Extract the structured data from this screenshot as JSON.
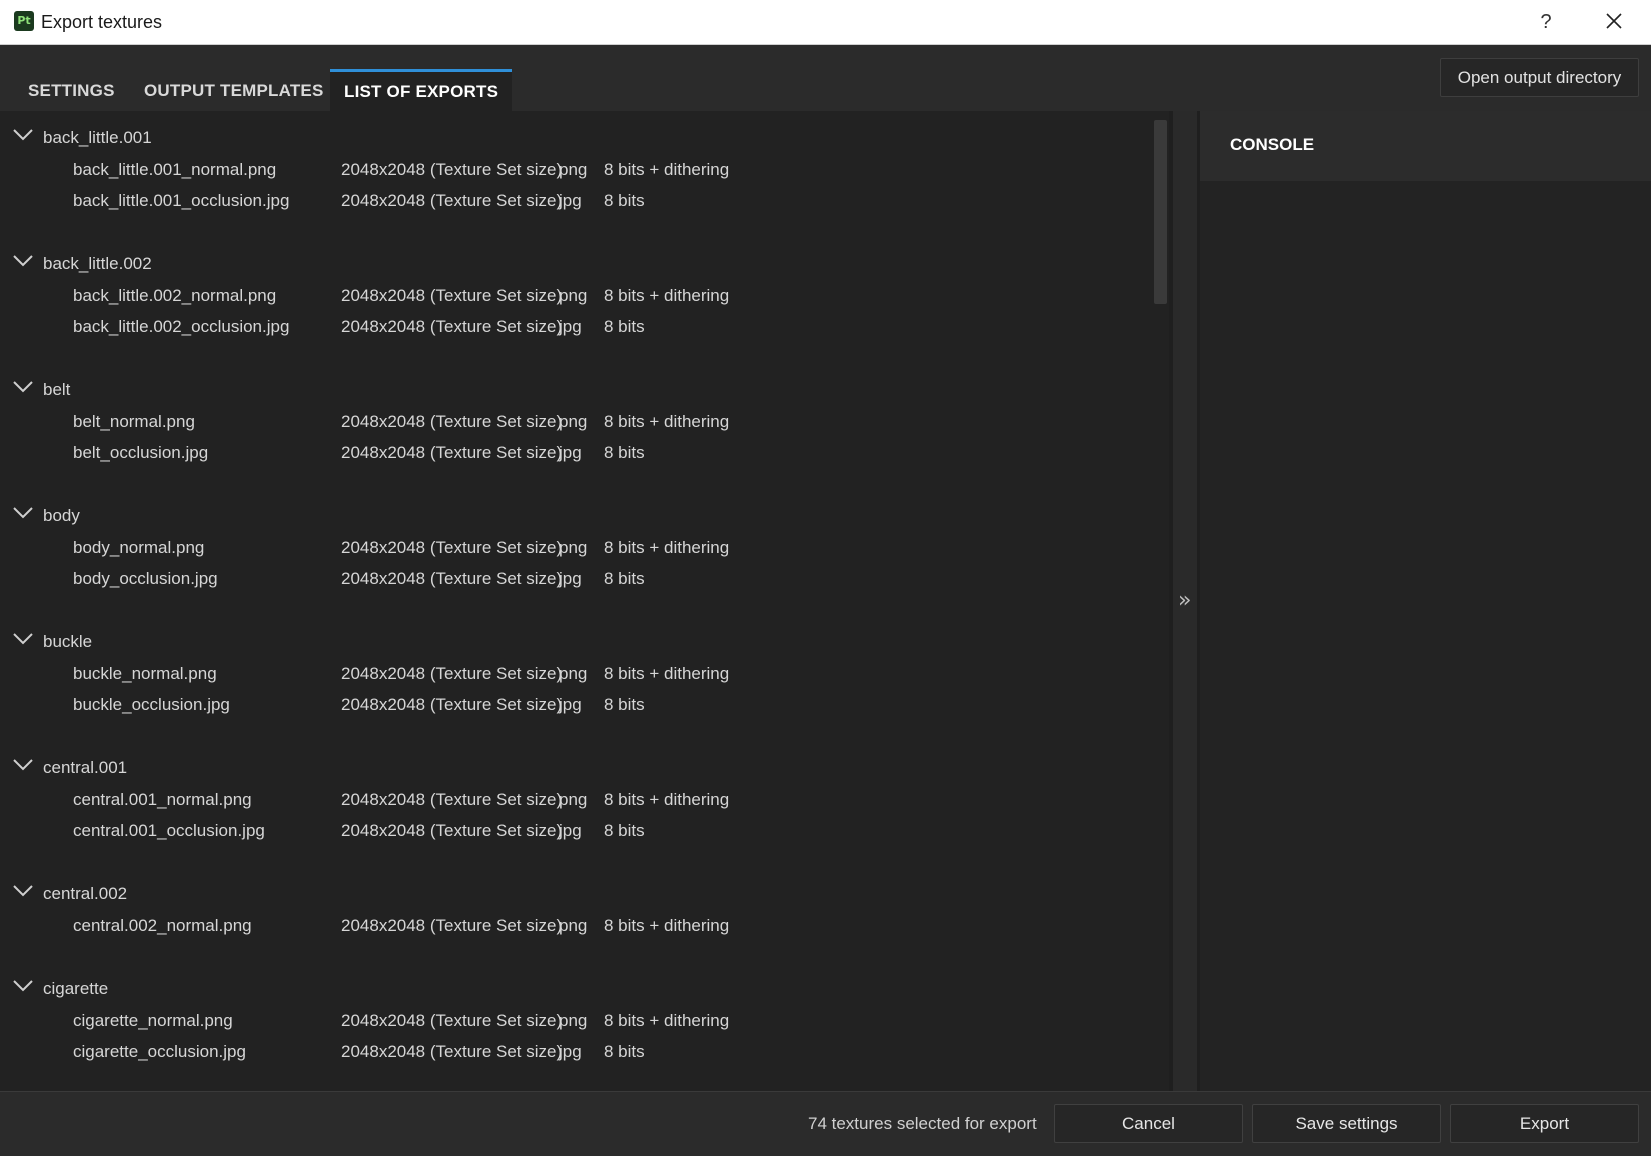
{
  "window": {
    "app_icon_text": "Pt",
    "title": "Export textures",
    "help_label": "?",
    "close_icon": "close-icon"
  },
  "tabs": [
    {
      "label": "SETTINGS",
      "active": false
    },
    {
      "label": "OUTPUT TEMPLATES",
      "active": false
    },
    {
      "label": "LIST OF EXPORTS",
      "active": true
    }
  ],
  "header_actions": {
    "open_output_directory": "Open output directory"
  },
  "exports": [
    {
      "name": "back_little.001",
      "files": [
        {
          "file": "back_little.001_normal.png",
          "size": "2048x2048 (Texture Set size)",
          "format": "png",
          "bits": "8 bits + dithering"
        },
        {
          "file": "back_little.001_occlusion.jpg",
          "size": "2048x2048 (Texture Set size)",
          "format": "jpg",
          "bits": "8 bits"
        }
      ]
    },
    {
      "name": "back_little.002",
      "files": [
        {
          "file": "back_little.002_normal.png",
          "size": "2048x2048 (Texture Set size)",
          "format": "png",
          "bits": "8 bits + dithering"
        },
        {
          "file": "back_little.002_occlusion.jpg",
          "size": "2048x2048 (Texture Set size)",
          "format": "jpg",
          "bits": "8 bits"
        }
      ]
    },
    {
      "name": "belt",
      "files": [
        {
          "file": "belt_normal.png",
          "size": "2048x2048 (Texture Set size)",
          "format": "png",
          "bits": "8 bits + dithering"
        },
        {
          "file": "belt_occlusion.jpg",
          "size": "2048x2048 (Texture Set size)",
          "format": "jpg",
          "bits": "8 bits"
        }
      ]
    },
    {
      "name": "body",
      "files": [
        {
          "file": "body_normal.png",
          "size": "2048x2048 (Texture Set size)",
          "format": "png",
          "bits": "8 bits + dithering"
        },
        {
          "file": "body_occlusion.jpg",
          "size": "2048x2048 (Texture Set size)",
          "format": "jpg",
          "bits": "8 bits"
        }
      ]
    },
    {
      "name": "buckle",
      "files": [
        {
          "file": "buckle_normal.png",
          "size": "2048x2048 (Texture Set size)",
          "format": "png",
          "bits": "8 bits + dithering"
        },
        {
          "file": "buckle_occlusion.jpg",
          "size": "2048x2048 (Texture Set size)",
          "format": "jpg",
          "bits": "8 bits"
        }
      ]
    },
    {
      "name": "central.001",
      "files": [
        {
          "file": "central.001_normal.png",
          "size": "2048x2048 (Texture Set size)",
          "format": "png",
          "bits": "8 bits + dithering"
        },
        {
          "file": "central.001_occlusion.jpg",
          "size": "2048x2048 (Texture Set size)",
          "format": "jpg",
          "bits": "8 bits"
        }
      ]
    },
    {
      "name": "central.002",
      "files": [
        {
          "file": "central.002_normal.png",
          "size": "2048x2048 (Texture Set size)",
          "format": "png",
          "bits": "8 bits + dithering"
        }
      ]
    },
    {
      "name": "cigarette",
      "files": [
        {
          "file": "cigarette_normal.png",
          "size": "2048x2048 (Texture Set size)",
          "format": "png",
          "bits": "8 bits + dithering"
        },
        {
          "file": "cigarette_occlusion.jpg",
          "size": "2048x2048 (Texture Set size)",
          "format": "jpg",
          "bits": "8 bits"
        }
      ]
    }
  ],
  "console": {
    "title": "CONSOLE"
  },
  "footer": {
    "status": "74 textures selected for export",
    "cancel_label": "Cancel",
    "save_label": "Save settings",
    "export_label": "Export"
  }
}
